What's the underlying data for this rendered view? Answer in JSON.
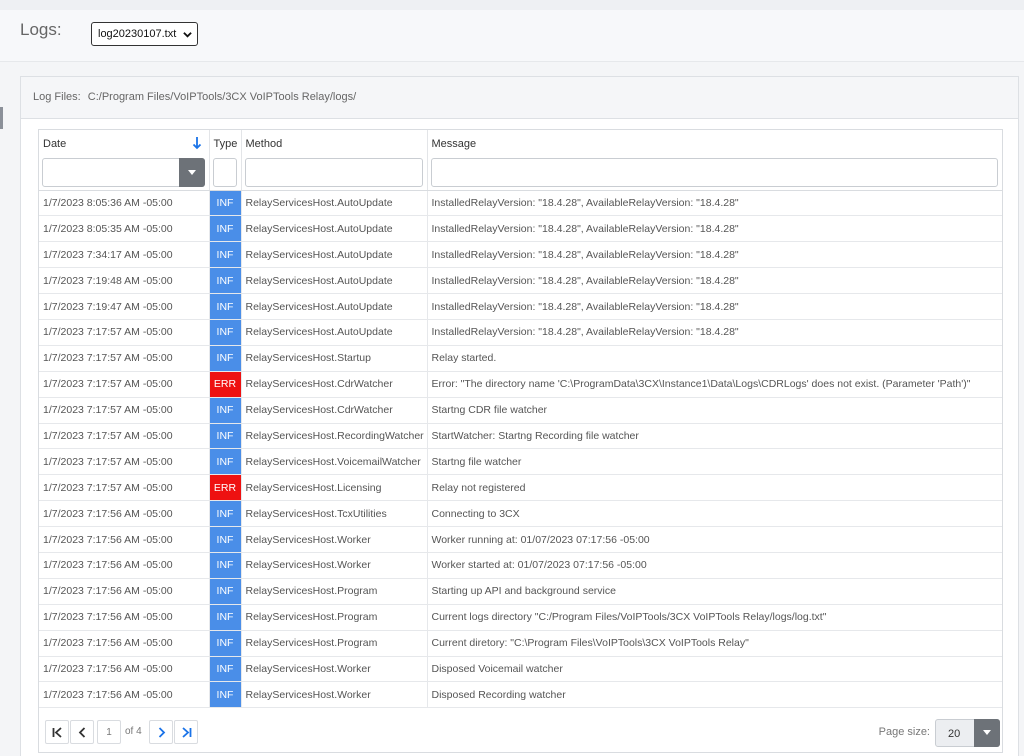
{
  "header": {
    "logs_label": "Logs:",
    "selected_log_file": "log20230107.txt"
  },
  "panel": {
    "heading_label": "Log Files:",
    "heading_path": "C:/Program Files/VoIPTools/3CX VoIPTools Relay/logs/"
  },
  "grid": {
    "columns": [
      {
        "label": "Date",
        "sorted": "descending"
      },
      {
        "label": "Type"
      },
      {
        "label": "Method"
      },
      {
        "label": "Message"
      }
    ],
    "rows": [
      {
        "date": "1/7/2023 8:05:36 AM -05:00",
        "type": "INF",
        "method": "RelayServicesHost.AutoUpdate",
        "message": "InstalledRelayVersion: \"18.4.28\", AvailableRelayVersion: \"18.4.28\""
      },
      {
        "date": "1/7/2023 8:05:35 AM -05:00",
        "type": "INF",
        "method": "RelayServicesHost.AutoUpdate",
        "message": "InstalledRelayVersion: \"18.4.28\", AvailableRelayVersion: \"18.4.28\""
      },
      {
        "date": "1/7/2023 7:34:17 AM -05:00",
        "type": "INF",
        "method": "RelayServicesHost.AutoUpdate",
        "message": "InstalledRelayVersion: \"18.4.28\", AvailableRelayVersion: \"18.4.28\""
      },
      {
        "date": "1/7/2023 7:19:48 AM -05:00",
        "type": "INF",
        "method": "RelayServicesHost.AutoUpdate",
        "message": "InstalledRelayVersion: \"18.4.28\", AvailableRelayVersion: \"18.4.28\""
      },
      {
        "date": "1/7/2023 7:19:47 AM -05:00",
        "type": "INF",
        "method": "RelayServicesHost.AutoUpdate",
        "message": "InstalledRelayVersion: \"18.4.28\", AvailableRelayVersion: \"18.4.28\""
      },
      {
        "date": "1/7/2023 7:17:57 AM -05:00",
        "type": "INF",
        "method": "RelayServicesHost.AutoUpdate",
        "message": "InstalledRelayVersion: \"18.4.28\", AvailableRelayVersion: \"18.4.28\""
      },
      {
        "date": "1/7/2023 7:17:57 AM -05:00",
        "type": "INF",
        "method": "RelayServicesHost.Startup",
        "message": "Relay started."
      },
      {
        "date": "1/7/2023 7:17:57 AM -05:00",
        "type": "ERR",
        "method": "RelayServicesHost.CdrWatcher",
        "message": "Error: \"The directory name 'C:\\ProgramData\\3CX\\Instance1\\Data\\Logs\\CDRLogs' does not exist. (Parameter 'Path')\""
      },
      {
        "date": "1/7/2023 7:17:57 AM -05:00",
        "type": "INF",
        "method": "RelayServicesHost.CdrWatcher",
        "message": "Startng CDR file watcher"
      },
      {
        "date": "1/7/2023 7:17:57 AM -05:00",
        "type": "INF",
        "method": "RelayServicesHost.RecordingWatcher",
        "message": "StartWatcher: Startng Recording file watcher"
      },
      {
        "date": "1/7/2023 7:17:57 AM -05:00",
        "type": "INF",
        "method": "RelayServicesHost.VoicemailWatcher",
        "message": "Startng file watcher"
      },
      {
        "date": "1/7/2023 7:17:57 AM -05:00",
        "type": "ERR",
        "method": "RelayServicesHost.Licensing",
        "message": "Relay not registered"
      },
      {
        "date": "1/7/2023 7:17:56 AM -05:00",
        "type": "INF",
        "method": "RelayServicesHost.TcxUtilities",
        "message": "Connecting to 3CX"
      },
      {
        "date": "1/7/2023 7:17:56 AM -05:00",
        "type": "INF",
        "method": "RelayServicesHost.Worker",
        "message": "Worker running at: 01/07/2023 07:17:56 -05:00"
      },
      {
        "date": "1/7/2023 7:17:56 AM -05:00",
        "type": "INF",
        "method": "RelayServicesHost.Worker",
        "message": "Worker started at: 01/07/2023 07:17:56 -05:00"
      },
      {
        "date": "1/7/2023 7:17:56 AM -05:00",
        "type": "INF",
        "method": "RelayServicesHost.Program",
        "message": "Starting up API and background service"
      },
      {
        "date": "1/7/2023 7:17:56 AM -05:00",
        "type": "INF",
        "method": "RelayServicesHost.Program",
        "message": "Current logs directory \"C:/Program Files/VoIPTools/3CX VoIPTools Relay/logs/log.txt\""
      },
      {
        "date": "1/7/2023 7:17:56 AM -05:00",
        "type": "INF",
        "method": "RelayServicesHost.Program",
        "message": "Current diretory: \"C:\\Program Files\\VoIPTools\\3CX VoIPTools Relay\""
      },
      {
        "date": "1/7/2023 7:17:56 AM -05:00",
        "type": "INF",
        "method": "RelayServicesHost.Worker",
        "message": "Disposed Voicemail watcher"
      },
      {
        "date": "1/7/2023 7:17:56 AM -05:00",
        "type": "INF",
        "method": "RelayServicesHost.Worker",
        "message": "Disposed Recording watcher"
      }
    ]
  },
  "pager": {
    "current_page": "1",
    "of_text": "of 4",
    "page_size_label": "Page size:",
    "page_size_value": "20"
  },
  "icons": {
    "sort": "arrow-down-icon",
    "dropdown": "caret-down-icon",
    "first": "first-page-icon",
    "prev": "prev-page-icon",
    "next": "next-page-icon",
    "last": "last-page-icon"
  },
  "colors": {
    "inf": "#4a8ee8",
    "err": "#ee1111",
    "pager_active": "#1a73e8"
  }
}
